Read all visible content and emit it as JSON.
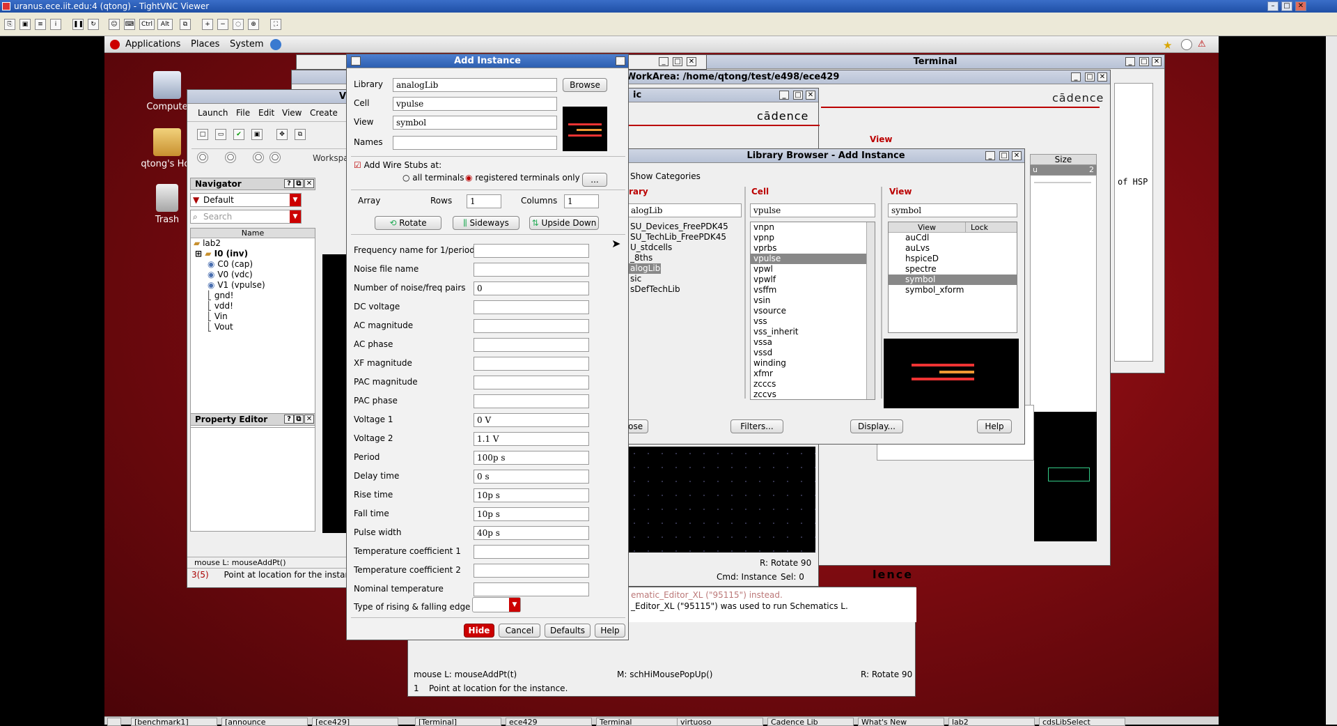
{
  "vnc": {
    "title": "uranus.ece.iit.edu:4 (qtong) - TightVNC Viewer",
    "ctrl": "Ctrl",
    "alt": "Alt"
  },
  "gnome": {
    "menus": [
      "Applications",
      "Places",
      "System"
    ]
  },
  "desktop_icons": [
    {
      "label": "Compute"
    },
    {
      "label": "qtong's Hor"
    },
    {
      "label": "Trash"
    }
  ],
  "virtuoso": {
    "title": "V",
    "menus": [
      "Launch",
      "File",
      "Edit",
      "View",
      "Create"
    ],
    "workspace": "Workspac",
    "navigator": {
      "title": "Navigator",
      "filter": "Default",
      "search_placeholder": "Search",
      "col": "Name",
      "items": [
        {
          "label": "lab2"
        },
        {
          "label": "I0 (inv)"
        },
        {
          "label": "C0 (cap)"
        },
        {
          "label": "V0 (vdc)"
        },
        {
          "label": "V1 (vpulse)"
        },
        {
          "label": "gnd!"
        },
        {
          "label": "vdd!"
        },
        {
          "label": "Vin"
        },
        {
          "label": "Vout"
        }
      ]
    },
    "property_editor": {
      "title": "Property Editor"
    },
    "status_mouse": "mouse L: mouseAddPt()",
    "status_count": "3(5)",
    "status_prompt": "Point at location for the instance.",
    "r_rotate": "R: Rotate 90",
    "cmd": "Cmd: Instance",
    "sel": "Sel: 0"
  },
  "add_instance": {
    "title": "Add Instance",
    "library_label": "Library",
    "library_value": "analogLib",
    "browse": "Browse",
    "cell_label": "Cell",
    "cell_value": "vpulse",
    "view_label": "View",
    "view_value": "symbol",
    "names_label": "Names",
    "names_value": "",
    "wire_stubs": "Add Wire Stubs at:",
    "all_terminals": "all terminals",
    "registered_terminals": "registered terminals only",
    "more": "...",
    "array": "Array",
    "rows_label": "Rows",
    "rows_value": "1",
    "columns_label": "Columns",
    "columns_value": "1",
    "rotate": "Rotate",
    "sideways": "Sideways",
    "upside_down": "Upside Down",
    "params": [
      {
        "label": "Frequency name for 1/period",
        "value": ""
      },
      {
        "label": "Noise file name",
        "value": ""
      },
      {
        "label": "Number of noise/freq pairs",
        "value": "0"
      },
      {
        "label": "DC voltage",
        "value": ""
      },
      {
        "label": "AC magnitude",
        "value": ""
      },
      {
        "label": "AC phase",
        "value": ""
      },
      {
        "label": "XF magnitude",
        "value": ""
      },
      {
        "label": "PAC magnitude",
        "value": ""
      },
      {
        "label": "PAC phase",
        "value": ""
      },
      {
        "label": "Voltage 1",
        "value": "0 V"
      },
      {
        "label": "Voltage 2",
        "value": "1.1 V"
      },
      {
        "label": "Period",
        "value": "100p s"
      },
      {
        "label": "Delay time",
        "value": "0 s"
      },
      {
        "label": "Rise time",
        "value": "10p s"
      },
      {
        "label": "Fall time",
        "value": "10p s"
      },
      {
        "label": "Pulse width",
        "value": "40p s"
      },
      {
        "label": "Temperature coefficient 1",
        "value": ""
      },
      {
        "label": "Temperature coefficient 2",
        "value": ""
      },
      {
        "label": "Nominal temperature",
        "value": ""
      }
    ],
    "edge_label": "Type of rising & falling edge",
    "hide": "Hide",
    "cancel": "Cancel",
    "defaults": "Defaults",
    "help": "Help"
  },
  "library_browser": {
    "title": "Library Browser - Add Instance",
    "show_categories": "Show Categories",
    "library_header": "rary",
    "cell_header": "Cell",
    "view_header": "View",
    "library_filter": "alogLib",
    "cell_filter": "vpulse",
    "view_filter": "symbol",
    "libraries": [
      "SU_Devices_FreePDK45",
      "SU_TechLib_FreePDK45",
      "U_stdcells",
      "_8ths",
      "alogLib",
      "sic",
      "sDefTechLib"
    ],
    "cells": [
      "vnpn",
      "vpnp",
      "vprbs",
      "vpulse",
      "vpwl",
      "vpwlf",
      "vsffm",
      "vsin",
      "vsource",
      "vss",
      "vss_inherit",
      "vssa",
      "vssd",
      "winding",
      "xfmr",
      "zcccs",
      "zccvs"
    ],
    "view_cols": [
      "View",
      "Lock"
    ],
    "views": [
      "auCdl",
      "auLvs",
      "hspiceD",
      "spectre",
      "symbol",
      "symbol_xform"
    ],
    "close": "lose",
    "filters": "Filters...",
    "display": "Display...",
    "help": "Help"
  },
  "schematic": {
    "title": "ic",
    "cadence": "cādence"
  },
  "workarea": {
    "title": "WorkArea: /home/qtong/test/e498/ece429",
    "cadence": "cādence",
    "view": "View",
    "size": "Size",
    "u": "u",
    "num": "2",
    "ience": "lence"
  },
  "terminal": {
    "title": "Terminal",
    "text": "of HSP"
  },
  "log": {
    "line1": "ematic_Editor_XL (\"95115\") instead.",
    "line2": "_Editor_XL (\"95115\") was used to run Schematics L.",
    "mouse": "mouse L: mouseAddPt(t)",
    "mid": "M: schHiMousePopUp()",
    "r": "R: Rotate 90",
    "num": "1",
    "prompt": "Point at location for the instance."
  },
  "taskbar": [
    "[benchmark1]",
    "[announce",
    "[ece429]",
    "[Terminal]",
    "ece429",
    "Terminal",
    "virtuoso",
    "Cadence Lib",
    "What's New",
    "lab2",
    "cdsLibSelect"
  ]
}
